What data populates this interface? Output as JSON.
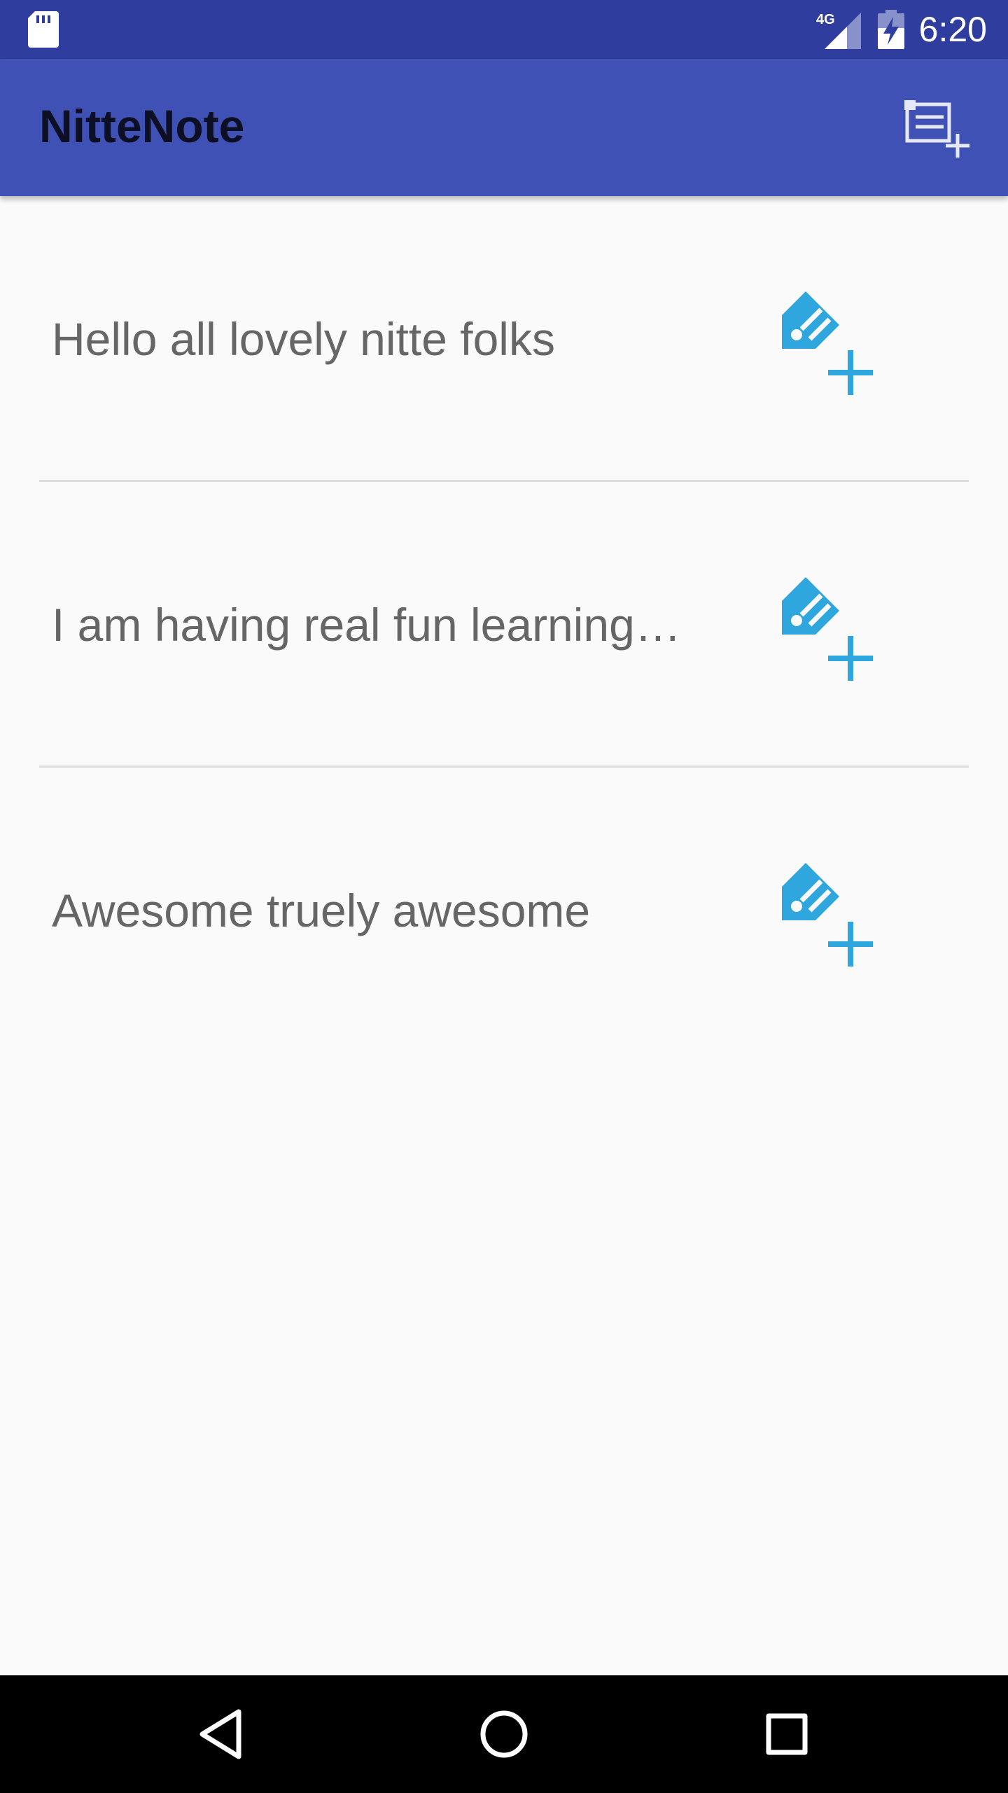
{
  "status_bar": {
    "time": "6:20",
    "network_label": "4G",
    "icons": [
      "sd-card-icon",
      "signal-icon",
      "battery-charging-icon"
    ]
  },
  "app_bar": {
    "title": "NitteNote",
    "action_icon": "new-note-icon"
  },
  "notes": [
    {
      "text": "Hello all lovely nitte folks",
      "action_icon": "edit-add-icon"
    },
    {
      "text": "I am having real fun learning…",
      "action_icon": "edit-add-icon"
    },
    {
      "text": "Awesome truely awesome",
      "action_icon": "edit-add-icon"
    }
  ],
  "nav_bar": {
    "buttons": [
      "back-icon",
      "home-icon",
      "recent-apps-icon"
    ]
  },
  "colors": {
    "status_bar": "#2f3e9e",
    "app_bar": "#3f51b5",
    "accent_icon": "#2fa6dd",
    "note_text": "#666666",
    "background": "#fafafa"
  }
}
